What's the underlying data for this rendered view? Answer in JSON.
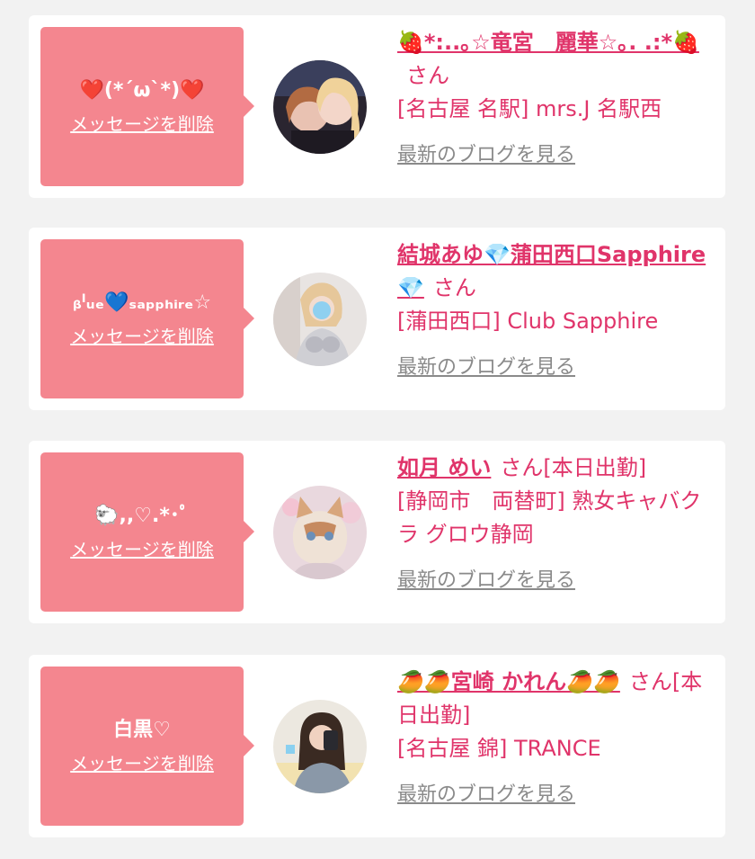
{
  "common": {
    "delete_label": "メッセージを削除",
    "blog_label": "最新のブログを見る",
    "san": "さん"
  },
  "cards": [
    {
      "bubble_message": "❤️(*´ω`*)❤️",
      "name": "🍓*:..｡☆竜宮　麗華☆｡. .:*🍓",
      "status": "",
      "shop": "[名古屋 名駅] mrs.J 名駅西"
    },
    {
      "bubble_message": "ᵦˡᵤₑ💙ₛₐₚₚₕᵢᵣₑ☆",
      "name": "結城あゆ💎蒲田西口Sapphire💎",
      "status": "",
      "shop": "[蒲田西口] Club Sapphire"
    },
    {
      "bubble_message": "🐑,,♡.*･ﾟ",
      "name": "如月 めい",
      "status": "[本日出勤]",
      "shop": "[静岡市　両替町] 熟女キャバクラ グロウ静岡"
    },
    {
      "bubble_message": "白黒♡",
      "name": "🥭🥭宮崎 かれん🥭🥭",
      "status": "[本日出勤]",
      "shop": "[名古屋 錦] TRANCE"
    }
  ]
}
